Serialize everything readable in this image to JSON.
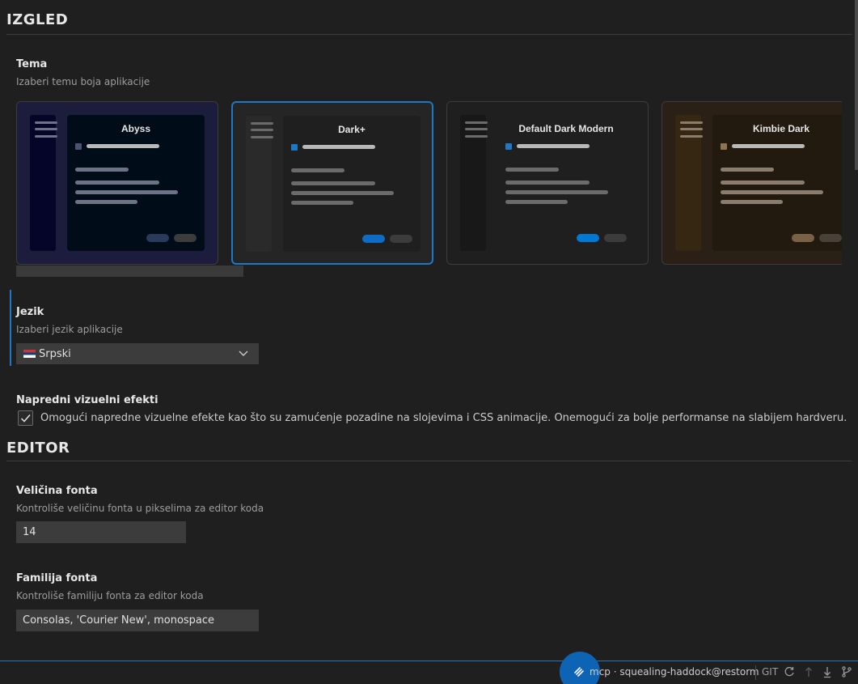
{
  "appearance": {
    "section_title": "IZGLED",
    "theme": {
      "label": "Tema",
      "description": "Izaberi temu boja aplikacije",
      "themes": [
        {
          "name": "Abyss",
          "selected": false,
          "bg": "#000c18",
          "frame": "#1c1c3d",
          "sidebar": "#05052a",
          "panel": "#000c18",
          "text": "#e6e6e6",
          "line": "#6c7386",
          "accent": "#4c5370",
          "accent_btn": "#2a3a5c",
          "btn": "#3c3c3c"
        },
        {
          "name": "Dark+",
          "selected": true,
          "bg": "#1e1e1e",
          "frame": "#252526",
          "sidebar": "#2a2a2a",
          "panel": "#1f1f1f",
          "text": "#e6e6e6",
          "line": "#6b6b6b",
          "accent": "#1e78c8",
          "accent_btn": "#0e6cc4",
          "btn": "#3c3c3c"
        },
        {
          "name": "Default Dark Modern",
          "selected": false,
          "bg": "#1f1f1f",
          "frame": "#1f1f1f",
          "sidebar": "#181818",
          "panel": "#1f1f1f",
          "text": "#e6e6e6",
          "line": "#6b6b6b",
          "accent": "#1e78c8",
          "accent_btn": "#0078d4",
          "btn": "#3c3c3c"
        },
        {
          "name": "Kimbie Dark",
          "selected": false,
          "bg": "#221a0f",
          "frame": "#2a2015",
          "sidebar": "#362712",
          "panel": "#221a0f",
          "text": "#e6e6e6",
          "line": "#8a7d6d",
          "accent": "#8f7450",
          "accent_btn": "#7a6145",
          "btn": "#4a4038"
        }
      ]
    },
    "language": {
      "label": "Jezik",
      "description": "Izaberi jezik aplikacije",
      "value": "Srpski"
    },
    "effects": {
      "label": "Napredni vizuelni efekti",
      "checked": true,
      "checkbox_label": "Omogući napredne vizuelne efekte kao što su zamućenje pozadine na slojevima i CSS animacije. Onemogući za bolje performanse na slabijem hardveru."
    }
  },
  "editor": {
    "section_title": "EDITOR",
    "font_size": {
      "label": "Veličina fonta",
      "description": "Kontroliše veličinu fonta u pikselima za editor koda",
      "value": "14"
    },
    "font_family": {
      "label": "Familija fonta",
      "description": "Kontroliše familiju fonta za editor koda",
      "value": "Consolas, 'Courier New', monospace"
    }
  },
  "statusbar": {
    "connection": "mcp · squealing-haddock@restorm",
    "git_label": "GIT"
  },
  "icons": {
    "fab": "link-icon",
    "refresh": "refresh-icon",
    "push": "push-arrow-icon",
    "pull": "pull-arrow-icon",
    "branch": "git-branch-icon",
    "chevron": "chevron-down-icon",
    "check": "check-icon"
  },
  "colors": {
    "accent": "#1e78c8",
    "background": "#1f1f1f"
  }
}
